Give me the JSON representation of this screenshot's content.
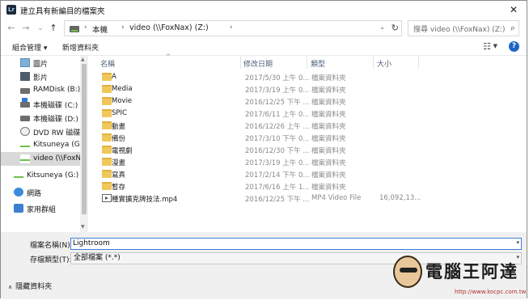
{
  "window": {
    "app_icon_text": "Lr",
    "title": "建立具有新編目的檔案夾",
    "close_symbol": "✕"
  },
  "nav": {
    "back_symbol": "←",
    "forward_symbol": "→",
    "recent_symbol": "⌄",
    "up_symbol": "↑",
    "breadcrumb": [
      "本機",
      "video (\\\\FoxNax) (Z:)"
    ],
    "separator": "›",
    "refresh_symbol": "↻",
    "search_placeholder": "搜尋 video (\\\\FoxNax) (Z:)",
    "search_icon_symbol": "⌕"
  },
  "toolbar": {
    "organize_label": "組合管理 ▾",
    "new_folder_label": "新增資料夾",
    "view_symbol": "☷",
    "view_dropdown": "▼",
    "help_symbol": "?"
  },
  "sidebar": {
    "items": [
      {
        "label": "圖片",
        "icon": "pictures-icon"
      },
      {
        "label": "影片",
        "icon": "videos-icon"
      },
      {
        "label": "RAMDisk (B:)",
        "icon": "drive-icon"
      },
      {
        "label": "本機磁碟 (C:)",
        "icon": "windows-drive-icon"
      },
      {
        "label": "本機磁碟 (D:)",
        "icon": "drive-icon"
      },
      {
        "label": "DVD RW 磁碟機",
        "icon": "dvd-icon"
      },
      {
        "label": "Kitsuneya (G:)",
        "icon": "network-drive-icon"
      },
      {
        "label": "video (\\\\FoxNa",
        "icon": "network-drive-icon",
        "selected": true
      },
      {
        "label": "Kitsuneya (G:)",
        "icon": "network-drive-icon"
      },
      {
        "label": "網路",
        "icon": "network-icon"
      },
      {
        "label": "家用群組",
        "icon": "homegroup-icon"
      }
    ]
  },
  "columns": {
    "name": "名稱",
    "date": "修改日期",
    "type": "類型",
    "size": "大小",
    "sort_symbol": "^"
  },
  "files": [
    {
      "name": "A",
      "date": "2017/5/30 上午 0...",
      "type": "檔案資料夾",
      "size": "",
      "kind": "folder"
    },
    {
      "name": "Media",
      "date": "2017/3/19 上午 0...",
      "type": "檔案資料夾",
      "size": "",
      "kind": "folder"
    },
    {
      "name": "Movie",
      "date": "2016/12/25 下午 ...",
      "type": "檔案資料夾",
      "size": "",
      "kind": "folder"
    },
    {
      "name": "SPIC",
      "date": "2017/6/11 上午 0...",
      "type": "檔案資料夾",
      "size": "",
      "kind": "folder"
    },
    {
      "name": "動畫",
      "date": "2016/12/26 上午 ...",
      "type": "檔案資料夾",
      "size": "",
      "kind": "folder"
    },
    {
      "name": "備份",
      "date": "2017/3/10 下午 0...",
      "type": "檔案資料夾",
      "size": "",
      "kind": "folder"
    },
    {
      "name": "電視劇",
      "date": "2016/12/30 下午 ...",
      "type": "檔案資料夾",
      "size": "",
      "kind": "folder"
    },
    {
      "name": "漫畫",
      "date": "2017/3/19 上午 0...",
      "type": "檔案資料夾",
      "size": "",
      "kind": "folder"
    },
    {
      "name": "寫真",
      "date": "2017/2/14 下午 0...",
      "type": "檔案資料夾",
      "size": "",
      "kind": "folder"
    },
    {
      "name": "暫存",
      "date": "2017/6/16 上午 1...",
      "type": "檔案資料夾",
      "size": "",
      "kind": "folder"
    },
    {
      "name": "種實擴克牌技法.mp4",
      "date": "2016/12/25 下午 ...",
      "type": "MP4 Video File",
      "size": "16,092,13...",
      "kind": "video"
    }
  ],
  "bottom": {
    "filename_label": "檔案名稱(N):",
    "filename_value": "Lightroom",
    "filetype_label": "存檔類型(T):",
    "filetype_value": "全部檔案 (*.*)",
    "dropdown_symbol": "▾",
    "hide_folders_label": "隱藏資料夾",
    "hide_folders_chevron": "∧"
  },
  "watermark": {
    "title": "電腦王阿達",
    "url": "http://www.kocpc.com.tw"
  }
}
